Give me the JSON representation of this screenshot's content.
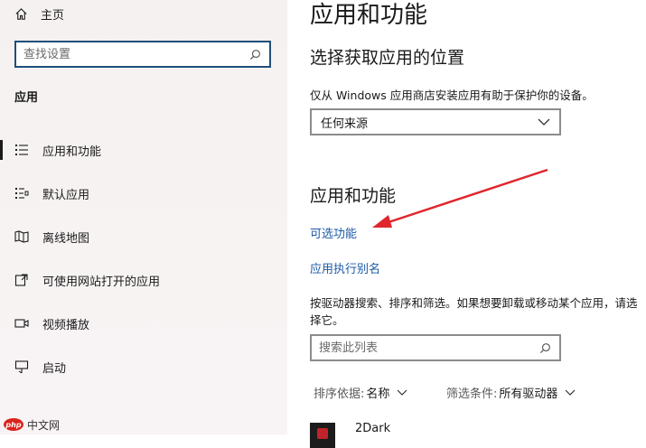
{
  "sidebar": {
    "home_label": "主页",
    "search_placeholder": "查找设置",
    "section_label": "应用",
    "items": [
      {
        "label": "应用和功能",
        "icon": "list-icon",
        "active": true
      },
      {
        "label": "默认应用",
        "icon": "default-apps-icon"
      },
      {
        "label": "离线地图",
        "icon": "map-icon"
      },
      {
        "label": "可使用网站打开的应用",
        "icon": "web-apps-icon"
      },
      {
        "label": "视频播放",
        "icon": "video-icon"
      },
      {
        "label": "启动",
        "icon": "startup-icon"
      }
    ]
  },
  "main": {
    "title": "应用和功能",
    "choose_location": {
      "heading": "选择获取应用的位置",
      "description": "仅从 Windows 应用商店安装应用有助于保护你的设备。",
      "select_value": "任何来源"
    },
    "apps_features": {
      "heading": "应用和功能",
      "optional_features_link": "可选功能",
      "alias_link": "应用执行别名",
      "paragraph": "按驱动器搜索、排序和筛选。如果想要卸载或移动某个应用，请选择它。",
      "search_placeholder": "搜索此列表",
      "sort_label": "排序依据:",
      "sort_value": "名称",
      "filter_label": "筛选条件:",
      "filter_value": "所有驱动器"
    },
    "app_list": [
      {
        "name": "2Dark"
      }
    ]
  },
  "watermark": {
    "logo_text": "php",
    "text": "中文网"
  },
  "colors": {
    "link": "#1c5aa6",
    "arrow": "#e0262c",
    "search_border": "#1f4f7a"
  }
}
